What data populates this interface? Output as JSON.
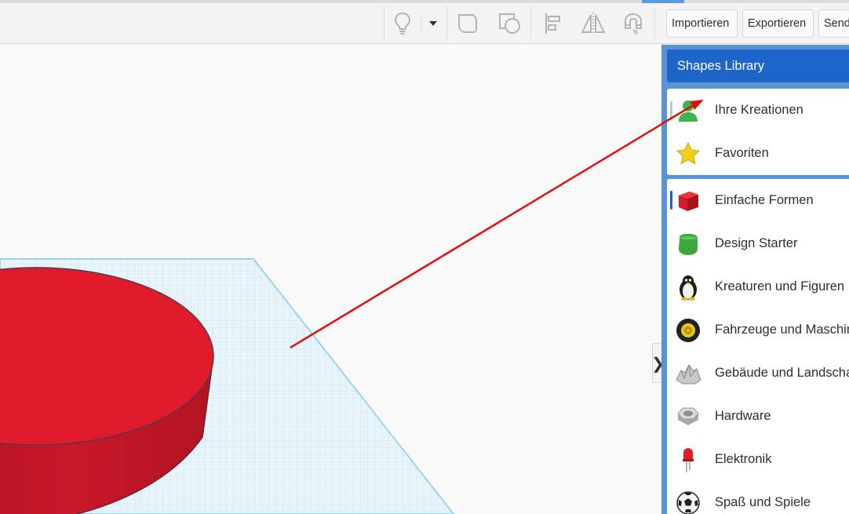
{
  "toolbar": {
    "import_label": "Importieren",
    "export_label": "Exportieren",
    "send_label": "Send",
    "icons": [
      "lightbulb-icon",
      "dropdown-caret-icon",
      "group-icon",
      "ungroup-icon",
      "align-icon",
      "mirror-icon",
      "magnet-icon"
    ]
  },
  "sidebar": {
    "title": "Shapes Library",
    "collapse_glyph": "❯",
    "personal": [
      {
        "label": "Ihre Kreationen",
        "icon": "user-icon"
      },
      {
        "label": "Favoriten",
        "icon": "star-icon"
      }
    ],
    "categories": [
      {
        "label": "Einfache Formen",
        "icon": "red-cube-icon"
      },
      {
        "label": "Design Starter",
        "icon": "green-shape-icon"
      },
      {
        "label": "Kreaturen und Figuren",
        "icon": "penguin-icon"
      },
      {
        "label": "Fahrzeuge und Maschinen",
        "icon": "wheel-icon"
      },
      {
        "label": "Gebäude und Landschaften",
        "icon": "rock-icon"
      },
      {
        "label": "Hardware",
        "icon": "nut-icon"
      },
      {
        "label": "Elektronik",
        "icon": "led-icon"
      },
      {
        "label": "Spaß und Spiele",
        "icon": "soccer-ball-icon"
      }
    ]
  },
  "colors": {
    "accent": "#1d65c8",
    "sidebar_bg": "#5a92d6",
    "shape": "#e01b2b",
    "arrow": "#e01010",
    "workplane": "#c9e9f5"
  }
}
